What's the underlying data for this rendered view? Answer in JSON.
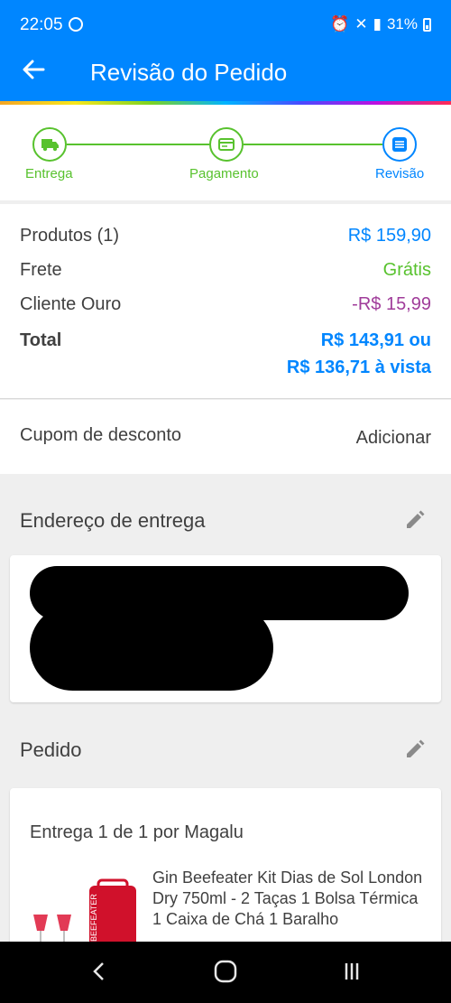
{
  "status_bar": {
    "time": "22:05",
    "icons": "⏰ 🔇 📶",
    "battery": "31%"
  },
  "header": {
    "title": "Revisão do Pedido",
    "back_icon": "arrow-left-icon",
    "accent_color": "#0086ff"
  },
  "steps": [
    {
      "label": "Entrega",
      "icon": "truck-icon",
      "state": "done"
    },
    {
      "label": "Pagamento",
      "icon": "card-icon",
      "state": "done"
    },
    {
      "label": "Revisão",
      "icon": "list-icon",
      "state": "active"
    }
  ],
  "summary": {
    "products_label": "Produtos (1)",
    "products_value": "R$ 159,90",
    "shipping_label": "Frete",
    "shipping_value": "Grátis",
    "client_label": "Cliente Ouro",
    "client_value": "-R$ 15,99",
    "total_label": "Total",
    "total_value_line1": "R$ 143,91 ou",
    "total_value_line2": "R$ 136,71 à vista",
    "colors": {
      "price": "#0086ff",
      "free": "#58c22e",
      "discount": "#a03c9a"
    }
  },
  "coupon": {
    "label": "Cupom de desconto",
    "action": "Adicionar"
  },
  "address": {
    "title": "Endereço de entrega",
    "edit_icon": "pencil-icon"
  },
  "order": {
    "title": "Pedido",
    "edit_icon": "pencil-icon",
    "delivery_title": "Entrega 1 de 1 por Magalu",
    "product_name": "Gin Beefeater Kit Dias de Sol London Dry 750ml - 2 Taças 1 Bolsa Térmica 1 Caixa de Chá 1 Baralho",
    "product_image_text": "BEEFEATER"
  },
  "navbar": {
    "back_icon": "nav-back-icon",
    "home_icon": "nav-home-icon",
    "recents_icon": "nav-recents-icon"
  }
}
